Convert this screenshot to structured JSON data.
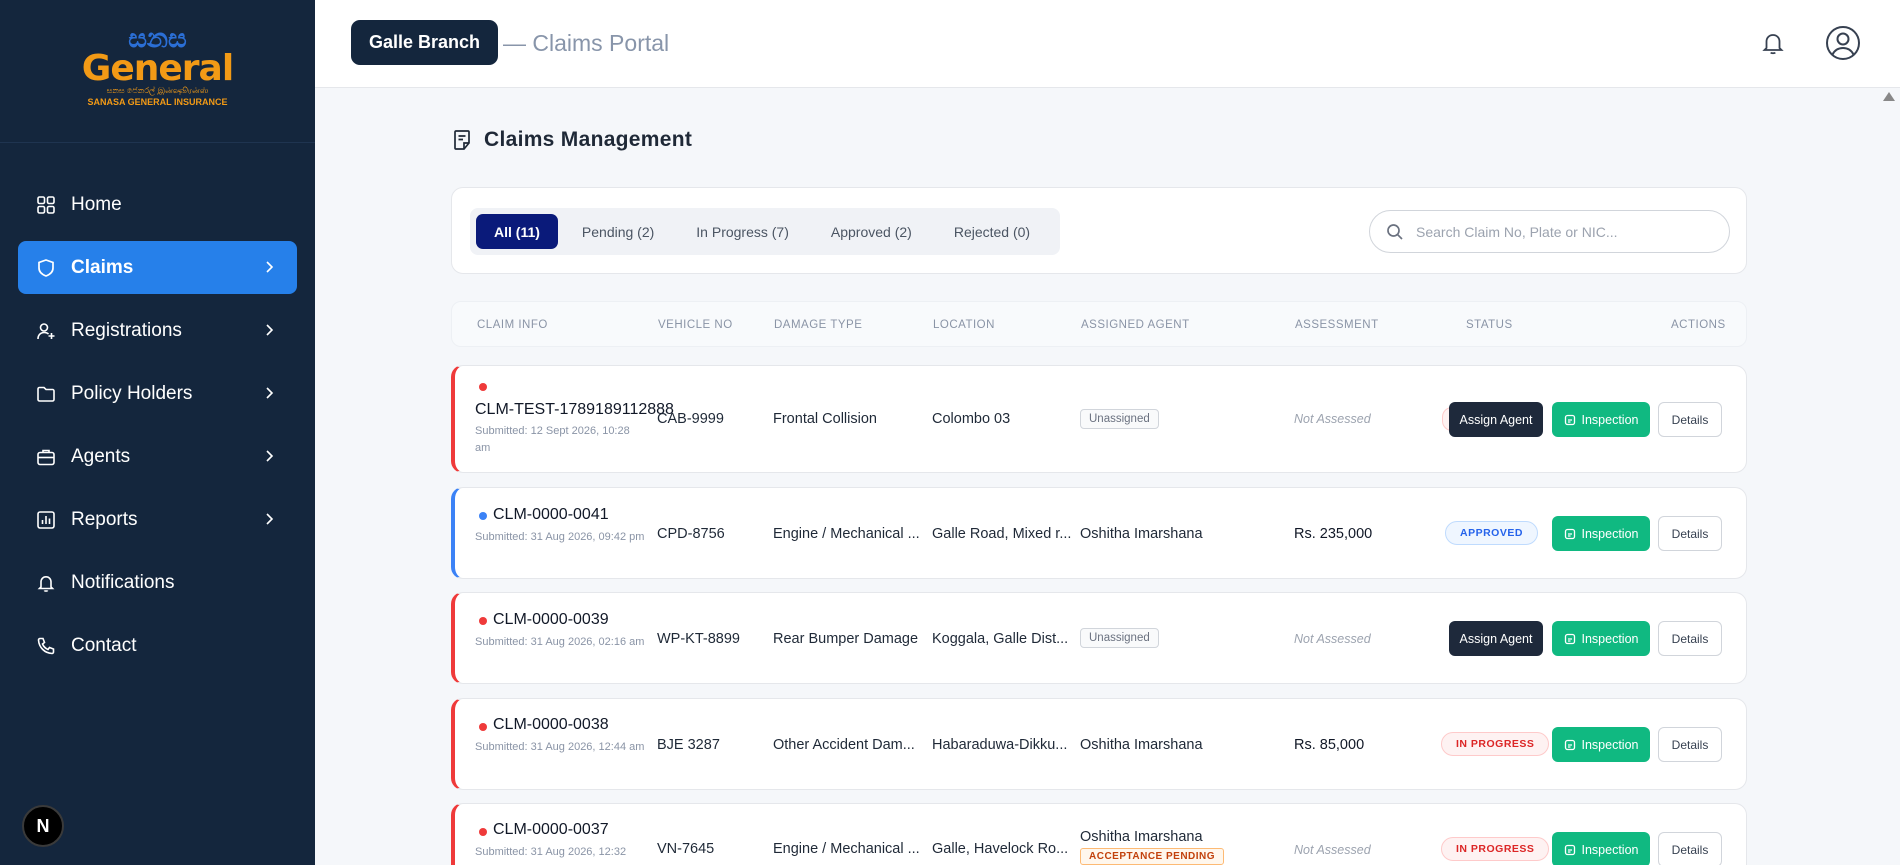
{
  "sidebar": {
    "logo": {
      "script": "සනස",
      "word": "General",
      "tagline": "සනස ජෙනරල් இன்ஷூரன்ஸ்",
      "company": "SANASA GENERAL INSURANCE"
    },
    "items": [
      {
        "label": "Home",
        "icon": "grid-icon",
        "active": false,
        "chevron": false
      },
      {
        "label": "Claims",
        "icon": "shield-icon",
        "active": true,
        "chevron": true
      },
      {
        "label": "Registrations",
        "icon": "user-plus-icon",
        "active": false,
        "chevron": true
      },
      {
        "label": "Policy Holders",
        "icon": "folder-icon",
        "active": false,
        "chevron": true
      },
      {
        "label": "Agents",
        "icon": "briefcase-icon",
        "active": false,
        "chevron": true
      },
      {
        "label": "Reports",
        "icon": "chart-icon",
        "active": false,
        "chevron": true
      },
      {
        "label": "Notifications",
        "icon": "bell-icon",
        "active": false,
        "chevron": false
      },
      {
        "label": "Contact",
        "icon": "phone-icon",
        "active": false,
        "chevron": false
      }
    ],
    "dev_badge": "N"
  },
  "header": {
    "branch": "Galle Branch",
    "portal": "— Claims Portal"
  },
  "main": {
    "title": "Claims Management",
    "tabs": [
      {
        "label": "All (11)",
        "active": true
      },
      {
        "label": "Pending (2)",
        "active": false
      },
      {
        "label": "In Progress (7)",
        "active": false
      },
      {
        "label": "Approved (2)",
        "active": false
      },
      {
        "label": "Rejected (0)",
        "active": false
      }
    ],
    "search_placeholder": "Search Claim No, Plate or NIC...",
    "columns": [
      "CLAIM INFO",
      "VEHICLE NO",
      "DAMAGE TYPE",
      "LOCATION",
      "ASSIGNED AGENT",
      "ASSESSMENT",
      "STATUS",
      "ACTIONS"
    ],
    "rows": [
      {
        "claim_no": "CLM-TEST-1789189112888",
        "submitted": "Submitted: 12 Sept 2026, 10:28 am",
        "vehicle": "CAB-9999",
        "damage": "Frontal Collision",
        "location": "Colombo 03",
        "agent": "Unassigned",
        "assessment": "Not Assessed",
        "status": "",
        "assign_label": "Assign Agent",
        "inspection_label": "Inspection",
        "details_label": "Details",
        "accent": "red"
      },
      {
        "claim_no": "CLM-0000-0041",
        "submitted": "Submitted: 31 Aug 2026, 09:42 pm",
        "vehicle": "CPD-8756",
        "damage": "Engine / Mechanical ...",
        "location": "Galle Road, Mixed r...",
        "agent": "Oshitha Imarshana",
        "assessment": "Rs. 235,000",
        "status": "APPROVED",
        "inspection_label": "Inspection",
        "details_label": "Details",
        "accent": "blue"
      },
      {
        "claim_no": "CLM-0000-0039",
        "submitted": "Submitted: 31 Aug 2026, 02:16 am",
        "vehicle": "WP-KT-8899",
        "damage": "Rear Bumper Damage",
        "location": "Koggala, Galle Dist...",
        "agent": "Unassigned",
        "assessment": "Not Assessed",
        "assign_label": "Assign Agent",
        "inspection_label": "Inspection",
        "details_label": "Details",
        "accent": "red"
      },
      {
        "claim_no": "CLM-0000-0038",
        "submitted": "Submitted: 31 Aug 2026, 12:44 am",
        "vehicle": "BJE 3287",
        "damage": "Other Accident Dam...",
        "location": "Habaraduwa-Dikku...",
        "agent": "Oshitha Imarshana",
        "assessment": "Rs. 85,000",
        "status": "IN PROGRESS",
        "inspection_label": "Inspection",
        "details_label": "Details",
        "accent": "red"
      },
      {
        "claim_no": "CLM-0000-0037",
        "submitted": "Submitted: 31 Aug 2026, 12:32",
        "vehicle": "VN-7645",
        "damage": "Engine / Mechanical ...",
        "location": "Galle, Havelock Ro...",
        "agent": "Oshitha Imarshana",
        "agent_badge": "ACCEPTANCE PENDING",
        "assessment": "Not Assessed",
        "status": "IN PROGRESS",
        "inspection_label": "Inspection",
        "details_label": "Details",
        "accent": "red"
      }
    ]
  },
  "colors": {
    "sidebar_bg": "#14263d",
    "active_nav": "#2680ea",
    "tab_active": "#0a1a7a",
    "inspection": "#10b981",
    "assign": "#1e293b",
    "urgent_dot": "#ef3a3a",
    "info_dot": "#3b82f6"
  }
}
